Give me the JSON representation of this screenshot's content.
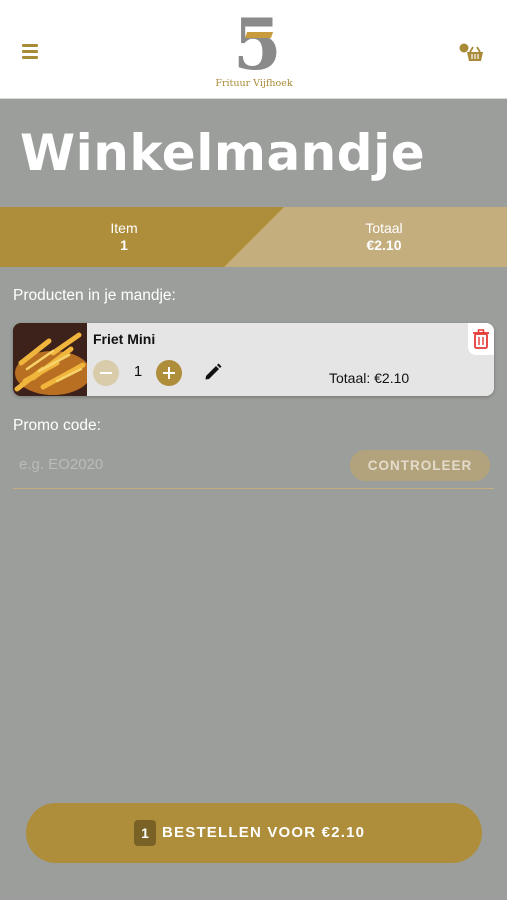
{
  "header": {
    "logo_number": "5",
    "logo_text": "Frituur Vijfhoek"
  },
  "page": {
    "title": "Winkelmandje"
  },
  "summary": {
    "items_label": "Item",
    "items_value": "1",
    "total_label": "Totaal",
    "total_value": "€2.10"
  },
  "cart": {
    "section_label": "Producten in je mandje:",
    "items": [
      {
        "name": "Friet Mini",
        "quantity": "1",
        "total_text": "Totaal: €2.10"
      }
    ]
  },
  "promo": {
    "label": "Promo code:",
    "placeholder": "e.g. EO2020",
    "value": "",
    "button_label": "CONTROLEER"
  },
  "order": {
    "count": "1",
    "label": "BESTELLEN VOOR €2.10"
  },
  "colors": {
    "accent": "#ae8d3b",
    "background": "#9b9e9a",
    "delete": "#e53935"
  }
}
